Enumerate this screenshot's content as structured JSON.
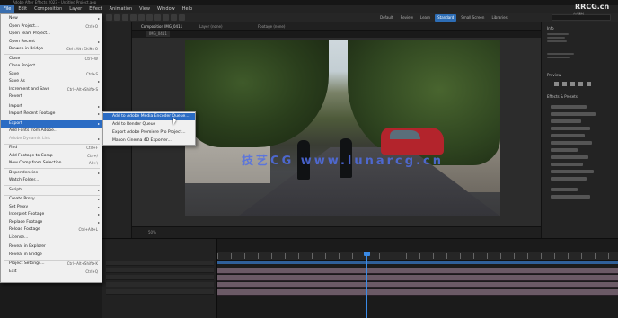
{
  "app": {
    "title": "Adobe After Effects 2023 - Untitled Project.aep"
  },
  "menubar": {
    "items": [
      "File",
      "Edit",
      "Composition",
      "Layer",
      "Effect",
      "Animation",
      "View",
      "Window",
      "Help"
    ]
  },
  "toolbar": {
    "workspaces": [
      "Default",
      "Review",
      "Learn",
      "Standard",
      "Small Screen",
      "Libraries"
    ],
    "current_workspace_index": 3
  },
  "file_menu": {
    "items": [
      {
        "label": "New",
        "shortcut": "",
        "submenu": true
      },
      {
        "label": "Open Project...",
        "shortcut": "Ctrl+O"
      },
      {
        "label": "Open Team Project...",
        "shortcut": ""
      },
      {
        "label": "Open Recent",
        "shortcut": "",
        "submenu": true
      },
      {
        "label": "Browse in Bridge...",
        "shortcut": "Ctrl+Alt+Shift+O"
      },
      {
        "label": "Close",
        "shortcut": "Ctrl+W"
      },
      {
        "label": "Close Project",
        "shortcut": ""
      },
      {
        "label": "Save",
        "shortcut": "Ctrl+S"
      },
      {
        "label": "Save As",
        "shortcut": "",
        "submenu": true
      },
      {
        "label": "Increment and Save",
        "shortcut": "Ctrl+Alt+Shift+S"
      },
      {
        "label": "Revert",
        "shortcut": ""
      },
      {
        "label": "Import",
        "shortcut": "",
        "submenu": true
      },
      {
        "label": "Import Recent Footage",
        "shortcut": "",
        "submenu": true
      },
      {
        "label": "Export",
        "shortcut": "",
        "submenu": true,
        "highlighted": true
      },
      {
        "label": "Add Fonts from Adobe...",
        "shortcut": ""
      },
      {
        "label": "Adobe Dynamic Link",
        "shortcut": "",
        "submenu": true,
        "dim": true
      },
      {
        "label": "Find",
        "shortcut": "Ctrl+F"
      },
      {
        "label": "Add Footage to Comp",
        "shortcut": "Ctrl+/"
      },
      {
        "label": "New Comp from Selection",
        "shortcut": "Alt+\\"
      },
      {
        "label": "Dependencies",
        "shortcut": "",
        "submenu": true
      },
      {
        "label": "Watch Folder...",
        "shortcut": ""
      },
      {
        "label": "Scripts",
        "shortcut": "",
        "submenu": true
      },
      {
        "label": "Create Proxy",
        "shortcut": "",
        "submenu": true
      },
      {
        "label": "Set Proxy",
        "shortcut": "",
        "submenu": true
      },
      {
        "label": "Interpret Footage",
        "shortcut": "",
        "submenu": true
      },
      {
        "label": "Replace Footage",
        "shortcut": "",
        "submenu": true
      },
      {
        "label": "Reload Footage",
        "shortcut": "Ctrl+Alt+L"
      },
      {
        "label": "License...",
        "shortcut": ""
      },
      {
        "label": "Reveal in Explorer",
        "shortcut": ""
      },
      {
        "label": "Reveal in Bridge",
        "shortcut": ""
      },
      {
        "label": "Project Settings...",
        "shortcut": "Ctrl+Alt+Shift+K"
      },
      {
        "label": "Exit",
        "shortcut": "Ctrl+Q"
      }
    ]
  },
  "export_submenu": {
    "items": [
      {
        "label": "Add to Adobe Media Encoder Queue...",
        "highlighted": true
      },
      {
        "label": "Add to Render Queue"
      },
      {
        "label": "Export Adobe Premiere Pro Project..."
      },
      {
        "label": "Maxon Cinema 4D Exporter..."
      }
    ]
  },
  "composition": {
    "tabs": [
      "Composition IMG_0411",
      "Layer (none)",
      "Footage (none)"
    ],
    "breadcrumb": "IMG_0411",
    "watermark": "技艺CG www.lunarcg.cn"
  },
  "viewer_footer": {
    "zoom": "50%",
    "resolution": "Full"
  },
  "right_panel": {
    "info_title": "Info",
    "audio_title": "Audio",
    "preview_title": "Preview",
    "effects_title": "Effects & Presets"
  },
  "timeline": {
    "layer_name": "IMG_0411.MOV"
  },
  "brand": {
    "name": "RRCG.cn",
    "sub": "人人素材"
  }
}
